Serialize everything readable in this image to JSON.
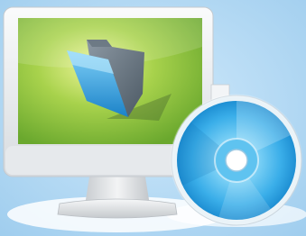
{
  "icons": [
    {
      "name": "monitor-icon"
    },
    {
      "name": "folder-icon"
    },
    {
      "name": "optical-disc-icon"
    }
  ],
  "colors": {
    "background": "#a9d3f0",
    "monitor_bezel": "#eef0f2",
    "screen_green": "#8cc63f",
    "screen_glow": "#e6f08a",
    "folder_blue": "#2a9fe0",
    "disc_blue": "#5cc4f3"
  }
}
